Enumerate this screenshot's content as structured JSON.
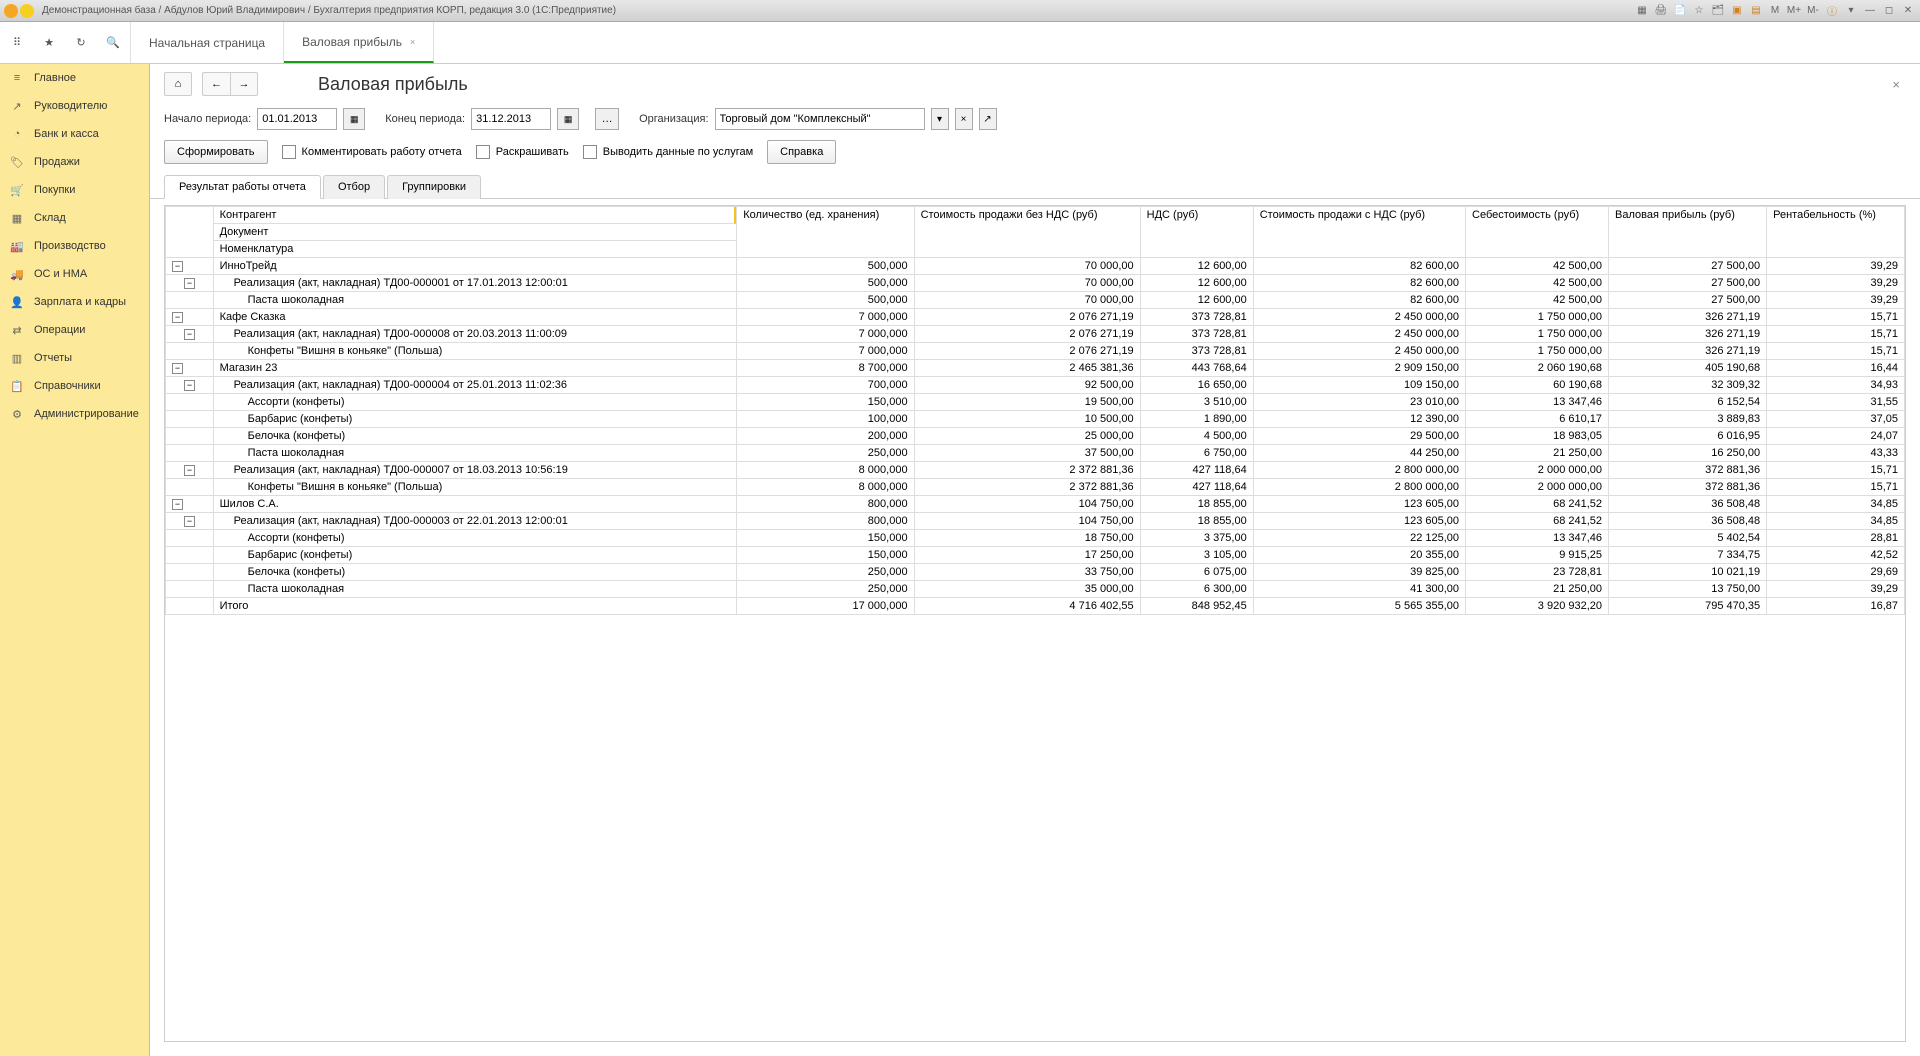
{
  "titlebar": {
    "text": "Демонстрационная база / Абдулов Юрий Владимирович / Бухгалтерия предприятия КОРП, редакция 3.0  (1С:Предприятие)",
    "right_icons": [
      "M",
      "M+",
      "M-"
    ]
  },
  "tabs": [
    {
      "label": "Начальная страница",
      "active": false
    },
    {
      "label": "Валовая прибыль",
      "active": true
    }
  ],
  "sidebar": {
    "items": [
      {
        "icon": "≡",
        "label": "Главное"
      },
      {
        "icon": "↗",
        "label": "Руководителю"
      },
      {
        "icon": "◔",
        "label": "Банк и касса"
      },
      {
        "icon": "🏷",
        "label": "Продажи"
      },
      {
        "icon": "🛒",
        "label": "Покупки"
      },
      {
        "icon": "▦",
        "label": "Склад"
      },
      {
        "icon": "🏭",
        "label": "Производство"
      },
      {
        "icon": "🚚",
        "label": "ОС и НМА"
      },
      {
        "icon": "👤",
        "label": "Зарплата и кадры"
      },
      {
        "icon": "⇄",
        "label": "Операции"
      },
      {
        "icon": "▥",
        "label": "Отчеты"
      },
      {
        "icon": "📋",
        "label": "Справочники"
      },
      {
        "icon": "⚙",
        "label": "Администрирование"
      }
    ]
  },
  "page": {
    "title": "Валовая прибыль"
  },
  "params": {
    "start_label": "Начало периода:",
    "start_value": "01.01.2013",
    "end_label": "Конец периода:",
    "end_value": "31.12.2013",
    "org_label": "Организация:",
    "org_value": "Торговый дом \"Комплексный\""
  },
  "actions": {
    "generate": "Сформировать",
    "comment": "Комментировать работу отчета",
    "colorize": "Раскрашивать",
    "by_service": "Выводить данные по услугам",
    "help": "Справка"
  },
  "subtabs": [
    {
      "label": "Результат работы отчета",
      "active": true
    },
    {
      "label": "Отбор",
      "active": false
    },
    {
      "label": "Группировки",
      "active": false
    }
  ],
  "report": {
    "header_left": [
      "Контрагент",
      "Документ",
      "Номенклатура"
    ],
    "columns": [
      "Количество (ед. хранения)",
      "Стоимость продажи без НДС (руб)",
      "НДС (руб)",
      "Стоимость продажи с НДС (руб)",
      "Себестоимость (руб)",
      "Валовая прибыль (руб)",
      "Рентабельность (%)"
    ],
    "rows": [
      {
        "level": 0,
        "exp": true,
        "label": "ИнноТрейд",
        "values": [
          "500,000",
          "70 000,00",
          "12 600,00",
          "82 600,00",
          "42 500,00",
          "27 500,00",
          "39,29"
        ]
      },
      {
        "level": 1,
        "exp": true,
        "label": "Реализация (акт, накладная) ТД00-000001 от 17.01.2013 12:00:01",
        "values": [
          "500,000",
          "70 000,00",
          "12 600,00",
          "82 600,00",
          "42 500,00",
          "27 500,00",
          "39,29"
        ]
      },
      {
        "level": 2,
        "label": "Паста шоколадная",
        "values": [
          "500,000",
          "70 000,00",
          "12 600,00",
          "82 600,00",
          "42 500,00",
          "27 500,00",
          "39,29"
        ]
      },
      {
        "level": 0,
        "exp": true,
        "label": "Кафе Сказка",
        "values": [
          "7 000,000",
          "2 076 271,19",
          "373 728,81",
          "2 450 000,00",
          "1 750 000,00",
          "326 271,19",
          "15,71"
        ]
      },
      {
        "level": 1,
        "exp": true,
        "label": "Реализация (акт, накладная) ТД00-000008 от 20.03.2013 11:00:09",
        "values": [
          "7 000,000",
          "2 076 271,19",
          "373 728,81",
          "2 450 000,00",
          "1 750 000,00",
          "326 271,19",
          "15,71"
        ]
      },
      {
        "level": 2,
        "label": "Конфеты \"Вишня в коньяке\"  (Польша)",
        "values": [
          "7 000,000",
          "2 076 271,19",
          "373 728,81",
          "2 450 000,00",
          "1 750 000,00",
          "326 271,19",
          "15,71"
        ]
      },
      {
        "level": 0,
        "exp": true,
        "label": "Магазин 23",
        "values": [
          "8 700,000",
          "2 465 381,36",
          "443 768,64",
          "2 909 150,00",
          "2 060 190,68",
          "405 190,68",
          "16,44"
        ]
      },
      {
        "level": 1,
        "exp": true,
        "label": "Реализация (акт, накладная) ТД00-000004 от 25.01.2013 11:02:36",
        "values": [
          "700,000",
          "92 500,00",
          "16 650,00",
          "109 150,00",
          "60 190,68",
          "32 309,32",
          "34,93"
        ]
      },
      {
        "level": 2,
        "label": "Ассорти (конфеты)",
        "values": [
          "150,000",
          "19 500,00",
          "3 510,00",
          "23 010,00",
          "13 347,46",
          "6 152,54",
          "31,55"
        ]
      },
      {
        "level": 2,
        "label": "Барбарис (конфеты)",
        "values": [
          "100,000",
          "10 500,00",
          "1 890,00",
          "12 390,00",
          "6 610,17",
          "3 889,83",
          "37,05"
        ]
      },
      {
        "level": 2,
        "label": "Белочка (конфеты)",
        "values": [
          "200,000",
          "25 000,00",
          "4 500,00",
          "29 500,00",
          "18 983,05",
          "6 016,95",
          "24,07"
        ]
      },
      {
        "level": 2,
        "label": "Паста шоколадная",
        "values": [
          "250,000",
          "37 500,00",
          "6 750,00",
          "44 250,00",
          "21 250,00",
          "16 250,00",
          "43,33"
        ]
      },
      {
        "level": 1,
        "exp": true,
        "label": "Реализация (акт, накладная) ТД00-000007 от 18.03.2013 10:56:19",
        "values": [
          "8 000,000",
          "2 372 881,36",
          "427 118,64",
          "2 800 000,00",
          "2 000 000,00",
          "372 881,36",
          "15,71"
        ]
      },
      {
        "level": 2,
        "label": "Конфеты \"Вишня в коньяке\"  (Польша)",
        "values": [
          "8 000,000",
          "2 372 881,36",
          "427 118,64",
          "2 800 000,00",
          "2 000 000,00",
          "372 881,36",
          "15,71"
        ]
      },
      {
        "level": 0,
        "exp": true,
        "label": "Шилов С.А.",
        "values": [
          "800,000",
          "104 750,00",
          "18 855,00",
          "123 605,00",
          "68 241,52",
          "36 508,48",
          "34,85"
        ]
      },
      {
        "level": 1,
        "exp": true,
        "label": "Реализация (акт, накладная) ТД00-000003 от 22.01.2013 12:00:01",
        "values": [
          "800,000",
          "104 750,00",
          "18 855,00",
          "123 605,00",
          "68 241,52",
          "36 508,48",
          "34,85"
        ]
      },
      {
        "level": 2,
        "label": "Ассорти (конфеты)",
        "values": [
          "150,000",
          "18 750,00",
          "3 375,00",
          "22 125,00",
          "13 347,46",
          "5 402,54",
          "28,81"
        ]
      },
      {
        "level": 2,
        "label": "Барбарис (конфеты)",
        "values": [
          "150,000",
          "17 250,00",
          "3 105,00",
          "20 355,00",
          "9 915,25",
          "7 334,75",
          "42,52"
        ]
      },
      {
        "level": 2,
        "label": "Белочка (конфеты)",
        "values": [
          "250,000",
          "33 750,00",
          "6 075,00",
          "39 825,00",
          "23 728,81",
          "10 021,19",
          "29,69"
        ]
      },
      {
        "level": 2,
        "label": "Паста шоколадная",
        "values": [
          "250,000",
          "35 000,00",
          "6 300,00",
          "41 300,00",
          "21 250,00",
          "13 750,00",
          "39,29"
        ]
      }
    ],
    "totals": {
      "label": "Итого",
      "values": [
        "17 000,000",
        "4 716 402,55",
        "848 952,45",
        "5 565 355,00",
        "3 920 932,20",
        "795 470,35",
        "16,87"
      ]
    }
  }
}
